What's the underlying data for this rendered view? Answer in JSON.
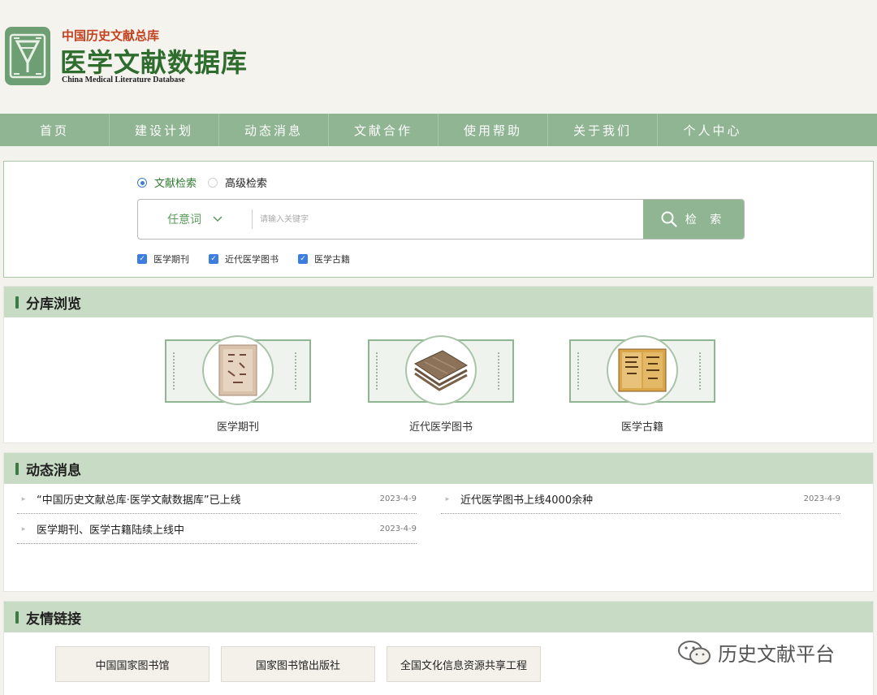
{
  "header": {
    "sub_title": "中国历史文献总库",
    "title": "医学文献数据库",
    "title_en": "China Medical Literature Database"
  },
  "nav": {
    "items": [
      "首页",
      "建设计划",
      "动态消息",
      "文献合作",
      "使用帮助",
      "关于我们",
      "个人中心"
    ]
  },
  "search": {
    "modes": [
      {
        "label": "文献检索",
        "selected": true
      },
      {
        "label": "高级检索",
        "selected": false
      }
    ],
    "scope": "任意词",
    "placeholder": "请输入关键字",
    "button": "检 索",
    "filters": [
      {
        "label": "医学期刊",
        "checked": true
      },
      {
        "label": "近代医学图书",
        "checked": true
      },
      {
        "label": "医学古籍",
        "checked": true
      }
    ]
  },
  "libraries": {
    "heading": "分库浏览",
    "items": [
      {
        "label": "医学期刊"
      },
      {
        "label": "近代医学图书"
      },
      {
        "label": "医学古籍"
      }
    ]
  },
  "news": {
    "heading": "动态消息",
    "items": [
      {
        "title": "“中国历史文献总库·医学文献数据库”已上线",
        "date": "2023-4-9"
      },
      {
        "title": "近代医学图书上线4000余种",
        "date": "2023-4-9"
      },
      {
        "title": "医学期刊、医学古籍陆续上线中",
        "date": "2023-4-9"
      }
    ]
  },
  "links": {
    "heading": "友情链接",
    "items": [
      "中国国家图书馆",
      "国家图书馆出版社",
      "全国文化信息资源共享工程"
    ]
  },
  "watermark": {
    "text": "历史文献平台"
  },
  "colors": {
    "nav_bg": "#8fb592",
    "section_head_bg": "#c8dcc5",
    "title_green": "#2f6d2f",
    "sub_title_red": "#c2411f",
    "checkbox_blue": "#3b7ee0"
  }
}
